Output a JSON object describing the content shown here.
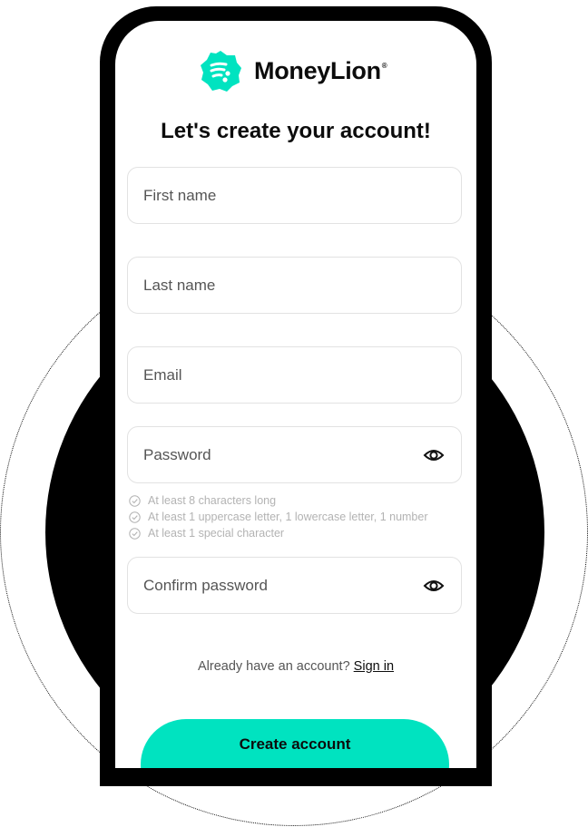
{
  "brand": {
    "name": "MoneyLion",
    "reg_mark": "®",
    "accent": "#00e3c0"
  },
  "form": {
    "heading": "Let's create your account!",
    "first_name": {
      "placeholder": "First name",
      "value": ""
    },
    "last_name": {
      "placeholder": "Last name",
      "value": ""
    },
    "email": {
      "placeholder": "Email",
      "value": ""
    },
    "password": {
      "placeholder": "Password",
      "value": "",
      "toggle_icon": "eye-icon"
    },
    "password_rules": [
      "At least 8 characters long",
      "At least 1 uppercase letter, 1 lowercase letter, 1 number",
      "At least 1 special character"
    ],
    "confirm_password": {
      "placeholder": "Confirm password",
      "value": "",
      "toggle_icon": "eye-icon"
    }
  },
  "signin": {
    "prompt": "Already have an account?",
    "link": "Sign in"
  },
  "cta": {
    "label": "Create account"
  }
}
